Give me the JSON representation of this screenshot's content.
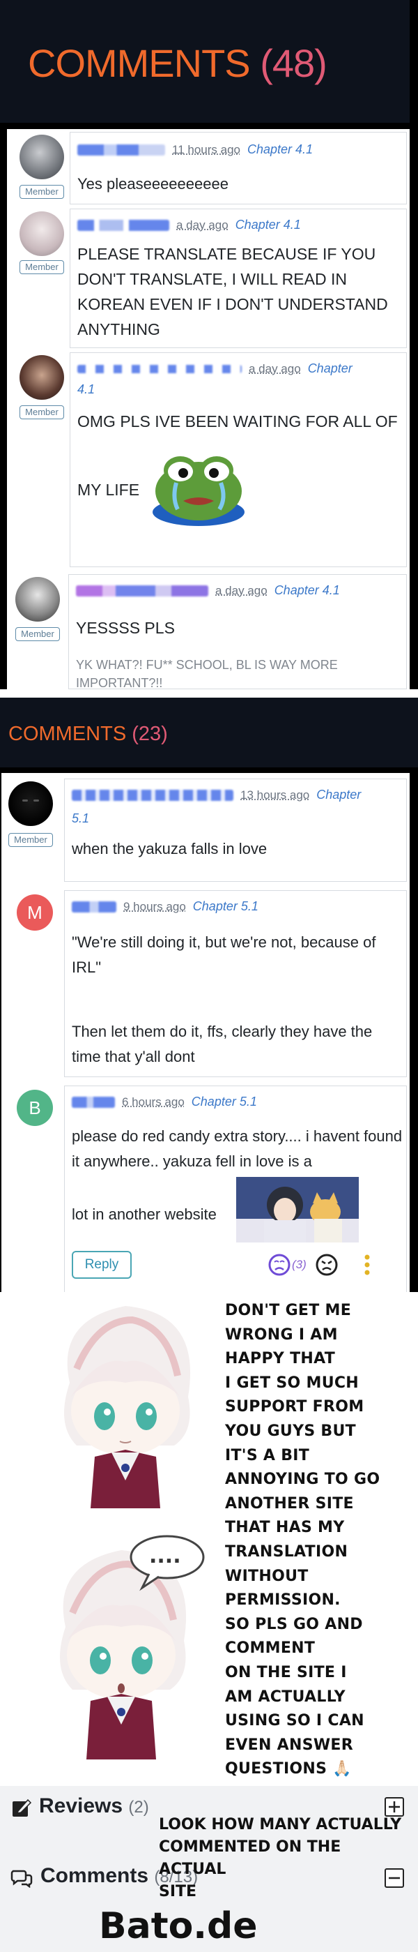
{
  "section1": {
    "title_word": "COMMENTS",
    "title_count": "(48)",
    "comments": [
      {
        "time": "11 hours ago",
        "chapter": "Chapter 4.1",
        "badge": "Member",
        "text": "Yes pleaseeeeeeeeee"
      },
      {
        "time": "a day ago",
        "chapter": "Chapter 4.1",
        "badge": "Member",
        "text": "PLEASE TRANSLATE BECAUSE IF YOU DON'T TRANSLATE, I WILL READ IN KOREAN EVEN IF I DON'T UNDERSTAND ANYTHING"
      },
      {
        "time": "a day ago",
        "chapter": "Chapter 4.1",
        "badge": "Member",
        "text": "OMG PLS IVE BEEN WAITING FOR ALL OF",
        "text2": "MY LIFE"
      },
      {
        "time": "a day ago",
        "chapter": "Chapter 4.1",
        "badge": "Member",
        "text": "YESSSS PLS",
        "text2": "YK WHAT?! FU** SCHOOL, BL IS WAY MORE IMPORTANT?!!"
      }
    ]
  },
  "section2": {
    "title_word": "COMMENTS",
    "title_count": "(23)",
    "comments": [
      {
        "time": "13 hours ago",
        "chapter": "Chapter 5.1",
        "badge": "Member",
        "text": "when the yakuza falls in love"
      },
      {
        "initial": "M",
        "time": "9 hours ago",
        "chapter": "Chapter 5.1",
        "text": "\"We're still doing it, but we're not, because of IRL\"",
        "text2": "Then let them do it, ffs, clearly they have the time that y'all dont"
      },
      {
        "initial": "B",
        "time": "6 hours ago",
        "chapter": "Chapter 5.1",
        "text": "please do red candy extra story.... i havent found it anywhere.. yakuza fell in love is a",
        "text2": "lot in another website",
        "reply": "Reply",
        "reaction_count": "(3)"
      }
    ]
  },
  "note": {
    "text": "Don't get me\nwrong I am\nhappy that\n I get so much\n support from\nyou guys but\n it's a bit\nannoying to go\nanother site\nthat has my\ntranslation\nwithout\npermission.\nSo pls go and\n comment\non the site I\nam actually\nusing so I can\n even answer\nquestions",
    "emoji": "🙏🏻",
    "bubble": "...."
  },
  "footer": {
    "reviews_label": "Reviews",
    "reviews_count": "(2)",
    "comments_label": "Comments",
    "comments_count": "(8/13)",
    "note": "Look how many actually\ncommented on the actual\nsite",
    "watermark": "Bato.de"
  },
  "colors": {
    "orange": "#f06a2c",
    "pink": "#e05a75",
    "link": "#3b78c9",
    "avatar_m": "#ea5a5a",
    "avatar_b": "#52b588",
    "reply": "#2e8fb0"
  }
}
